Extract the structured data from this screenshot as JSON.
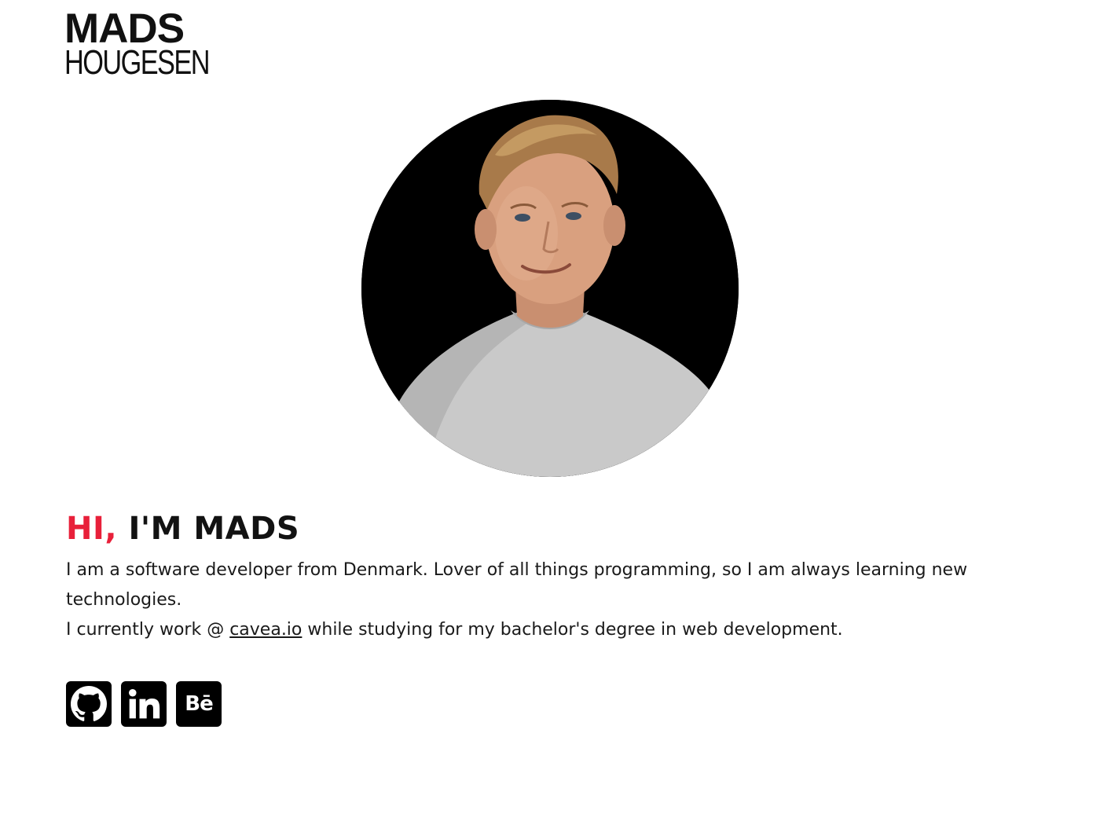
{
  "logo": {
    "line1": "MADS",
    "line2": "HOUGESEN"
  },
  "hero": {
    "greeting_accent": "HI,",
    "greeting_rest": " I'M MADS",
    "bio_line1": "I am a software developer from Denmark. Lover of all things programming, so I am always learning new technologies.",
    "bio_line2_before": "I currently work @ ",
    "bio_link": "cavea.io",
    "bio_line2_after": " while studying for my bachelor's degree in web development."
  },
  "socials": [
    {
      "icon": "github-icon",
      "label": ""
    },
    {
      "icon": "linkedin-icon",
      "label": ""
    },
    {
      "icon": "behance-icon",
      "label": "Bē"
    }
  ],
  "colors": {
    "accent": "#e8203a",
    "text": "#121212",
    "icon_bg": "#000000"
  }
}
